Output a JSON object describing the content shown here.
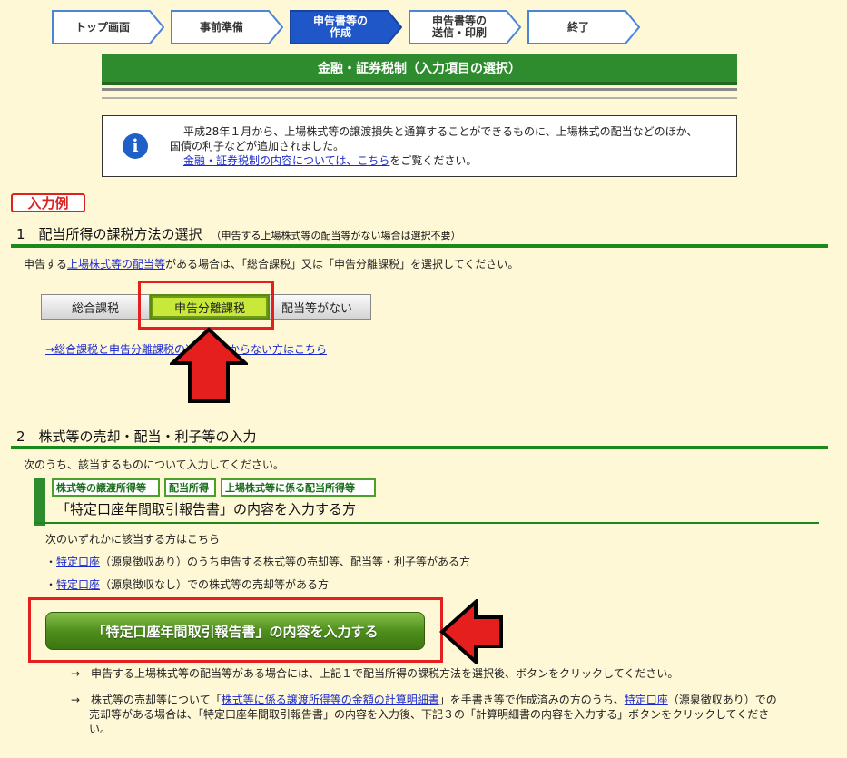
{
  "steps": [
    {
      "label": "トップ画面",
      "active": false
    },
    {
      "label": "事前準備",
      "active": false
    },
    {
      "label": "申告書等の\n作成",
      "active": true
    },
    {
      "label": "申告書等の\n送信・印刷",
      "active": false
    },
    {
      "label": "終了",
      "active": false
    }
  ],
  "page_title": "金融・証券税制（入力項目の選択）",
  "info": {
    "icon": "info-icon",
    "line1": "平成28年１月から、上場株式等の譲渡損失と通算することができるものに、上場株式の配当などのほか、",
    "line2": "国債の利子などが追加されました。",
    "link": "金融・証券税制の内容については、こちら",
    "link_suffix": "をご覧ください。"
  },
  "example_badge": "入力例",
  "section1": {
    "title": "1　配当所得の課税方法の選択",
    "subtitle": "（申告する上場株式等の配当等がない場合は選択不要）",
    "instr_prefix": "申告する",
    "instr_link": "上場株式等の配当等",
    "instr_suffix": "がある場合は、「総合課税」又は「申告分離課税」を選択してください。",
    "options": [
      {
        "label": "総合課税",
        "selected": false
      },
      {
        "label": "申告分離課税",
        "selected": true
      },
      {
        "label": "配当等がない",
        "selected": false
      }
    ],
    "help_link": "→総合課税と申告分離課税の違いがわからない方はこちら"
  },
  "section2": {
    "title": "2　株式等の売却・配当・利子等の入力",
    "instr": "次のうち、該当するものについて入力してください。",
    "tags": [
      "株式等の譲渡所得等",
      "配当所得",
      "上場株式等に係る配当所得等"
    ],
    "subhead": "「特定口座年間取引報告書」の内容を入力する方",
    "intro": "次のいずれかに該当する方はこちら",
    "items": [
      {
        "prefix": "・",
        "link": "特定口座",
        "text": "（源泉徴収あり）のうち申告する株式等の売却等、配当等・利子等がある方"
      },
      {
        "prefix": "・",
        "link": "特定口座",
        "text": "（源泉徴収なし）での株式等の売却等がある方"
      }
    ],
    "button": "「特定口座年間取引報告書」の内容を入力する",
    "note1": "→　申告する上場株式等の配当等がある場合には、上記１で配当所得の課税方法を選択後、ボタンをクリックしてください。",
    "note2_a": "→　株式等の売却等について「",
    "note2_link1": "株式等に係る譲渡所得等の金額の計算明細書",
    "note2_b": "」を手書き等で作成済みの方のうち、",
    "note2_link2": "特定口座",
    "note2_c": "（源泉徴収あり）での",
    "note2_line2": "売却等がある場合は、「特定口座年間取引報告書」の内容を入力後、下記３の「計算明細書の内容を入力する」ボタンをクリックしてくださ",
    "note2_line3": "い。"
  },
  "colors": {
    "green": "#2e8b2e",
    "red": "#e51e1e",
    "background": "#fff8d6",
    "active_step": "#1f56c8",
    "link": "#1a2ad0"
  }
}
